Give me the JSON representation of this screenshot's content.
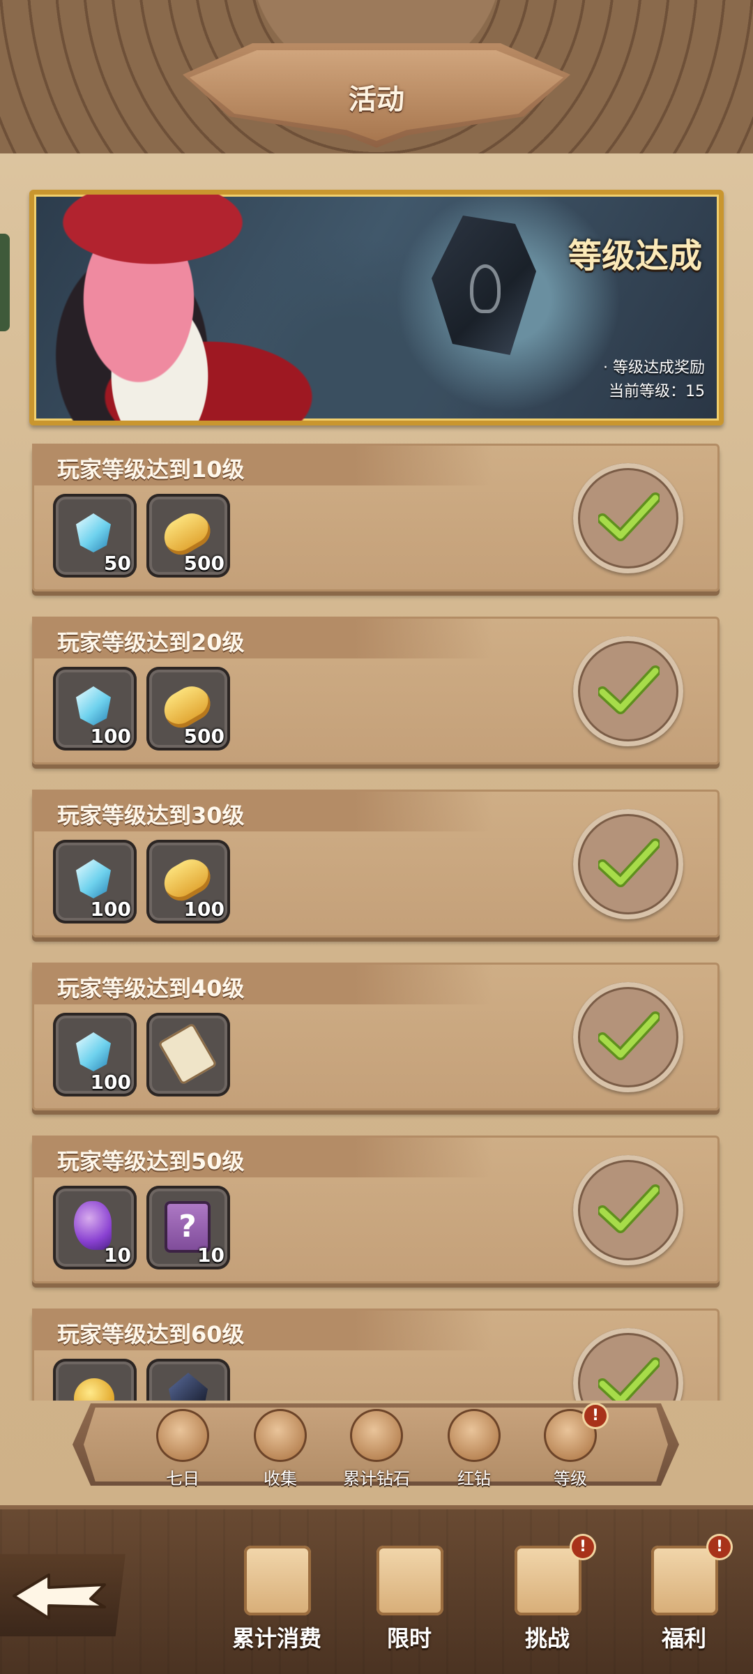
{
  "header": {
    "title": "活动"
  },
  "banner": {
    "title": "等级达成",
    "reward_line": "· 等级达成奖励",
    "current_level_label": "当前等级：",
    "current_level": "15"
  },
  "tasks": [
    {
      "title": "玩家等级达到10级",
      "status": "completed",
      "rewards": [
        {
          "icon": "diamond-icon",
          "qty": "50"
        },
        {
          "icon": "bread-icon",
          "qty": "500"
        }
      ]
    },
    {
      "title": "玩家等级达到20级",
      "status": "completed",
      "rewards": [
        {
          "icon": "diamond-icon",
          "qty": "100"
        },
        {
          "icon": "bread-icon",
          "qty": "500"
        }
      ]
    },
    {
      "title": "玩家等级达到30级",
      "status": "completed",
      "rewards": [
        {
          "icon": "diamond-icon",
          "qty": "100"
        },
        {
          "icon": "bread-icon",
          "qty": "100"
        }
      ]
    },
    {
      "title": "玩家等级达到40级",
      "status": "completed",
      "rewards": [
        {
          "icon": "diamond-icon",
          "qty": "100"
        },
        {
          "icon": "scroll-icon",
          "qty": ""
        }
      ]
    },
    {
      "title": "玩家等级达到50级",
      "status": "completed",
      "rewards": [
        {
          "icon": "spirit-icon",
          "qty": "10"
        },
        {
          "icon": "mystery-scroll-icon",
          "qty": "10"
        }
      ]
    },
    {
      "title": "玩家等级达到60级",
      "status": "completed",
      "rewards": [
        {
          "icon": "coin-icon",
          "qty": ""
        },
        {
          "icon": "crystal-icon",
          "qty": ""
        }
      ]
    }
  ],
  "activity_tabs": [
    {
      "label": "七日",
      "icon": "seven-day-scroll-icon",
      "alert": false
    },
    {
      "label": "收集",
      "icon": "book-icon",
      "alert": false
    },
    {
      "label": "累计钻石",
      "icon": "diamond-bag-icon",
      "alert": false
    },
    {
      "label": "红钻",
      "icon": "money-bag-icon",
      "alert": false
    },
    {
      "label": "等级",
      "icon": "treasure-chest-icon",
      "alert": true,
      "alert_text": "!"
    }
  ],
  "bottom_nav": [
    {
      "label": "累计消费",
      "icon": "gift-box-icon",
      "alert": false
    },
    {
      "label": "限时",
      "icon": "banner-flag-icon",
      "alert": false
    },
    {
      "label": "挑战",
      "icon": "sword-icon",
      "alert": true,
      "alert_text": "!"
    },
    {
      "label": "福利",
      "icon": "welfare-card-icon",
      "alert": true,
      "alert_text": "!"
    }
  ],
  "colors": {
    "accent_gold": "#c9962f",
    "check_green": "#8fc63b",
    "alert_red": "#a8321a",
    "parchment": "#cfae86"
  }
}
